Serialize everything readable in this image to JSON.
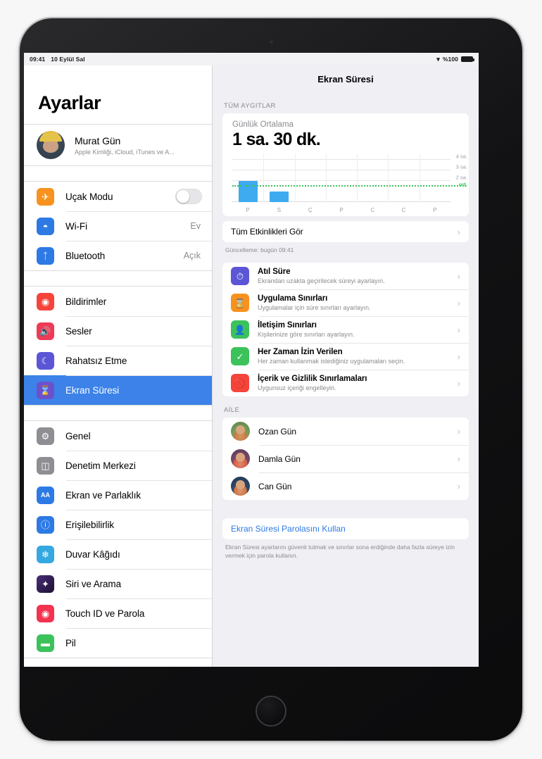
{
  "status_bar": {
    "time": "09:41",
    "date": "10 Eylül Sal",
    "wifi_icon": "wifi-icon",
    "battery_percent": "%100",
    "battery_icon": "battery-full-icon"
  },
  "sidebar": {
    "title": "Ayarlar",
    "user": {
      "name": "Murat Gün",
      "subtitle": "Apple Kimliği, iCloud, iTunes ve A..."
    },
    "group1": [
      {
        "label": "Uçak Modu",
        "icon": "airplane-icon",
        "icon_color": "#f7921e",
        "control": "toggle",
        "toggle_on": false
      },
      {
        "label": "Wi-Fi",
        "icon": "wifi-icon",
        "icon_color": "#2d7ae5",
        "value": "Ev"
      },
      {
        "label": "Bluetooth",
        "icon": "bluetooth-icon",
        "icon_color": "#2d7ae5",
        "value": "Açık"
      }
    ],
    "group2": [
      {
        "label": "Bildirimler",
        "icon": "notifications-icon",
        "icon_color": "#f5453b"
      },
      {
        "label": "Sesler",
        "icon": "speaker-icon",
        "icon_color": "#ee3a56"
      },
      {
        "label": "Rahatsız Etme",
        "icon": "moon-icon",
        "icon_color": "#5b56d6"
      },
      {
        "label": "Ekran Süresi",
        "icon": "hourglass-icon",
        "icon_color": "#6a52cf",
        "selected": true
      }
    ],
    "group3": [
      {
        "label": "Genel",
        "icon": "gear-icon",
        "icon_color": "#8e8e93"
      },
      {
        "label": "Denetim Merkezi",
        "icon": "control-center-icon",
        "icon_color": "#8e8e93"
      },
      {
        "label": "Ekran ve Parlaklık",
        "icon": "display-icon",
        "icon_color": "#2d7ae5",
        "glyph": "AA"
      },
      {
        "label": "Erişilebilirlik",
        "icon": "accessibility-icon",
        "icon_color": "#2d7ae5"
      },
      {
        "label": "Duvar Kâğıdı",
        "icon": "wallpaper-icon",
        "icon_color": "#35a8e0"
      },
      {
        "label": "Siri ve Arama",
        "icon": "siri-icon",
        "icon_color": "#2b1b4a"
      },
      {
        "label": "Touch ID ve Parola",
        "icon": "touchid-icon",
        "icon_color": "#f3334f"
      },
      {
        "label": "Pil",
        "icon": "battery-icon",
        "icon_color": "#3cc25b"
      }
    ]
  },
  "detail": {
    "header_title": "Ekran Süresi",
    "all_devices_header": "TÜM AYGITLAR",
    "daily_average_label": "Günlük Ortalama",
    "daily_average_value": "1 sa. 30 dk.",
    "see_all_activity": "Tüm Etkinlikleri Gör",
    "update_note": "Güncelleme: bugün 09:41",
    "settings_rows": [
      {
        "title": "Atıl Süre",
        "subtitle": "Ekrandan uzakta geçirilecek süreyi ayarlayın.",
        "icon": "downtime-icon",
        "icon_color": "#5b56d6"
      },
      {
        "title": "Uygulama Sınırları",
        "subtitle": "Uygulamalar için süre sınırları ayarlayın.",
        "icon": "hourglass-icon",
        "icon_color": "#f7921e"
      },
      {
        "title": "İletişim Sınırları",
        "subtitle": "Kişilerinize göre sınırları ayarlayın.",
        "icon": "person-icon",
        "icon_color": "#3cc25b"
      },
      {
        "title": "Her Zaman İzin Verilen",
        "subtitle": "Her zaman kullanmak istediğiniz uygulamaları seçin.",
        "icon": "checkmark-icon",
        "icon_color": "#3cc25b"
      },
      {
        "title": "İçerik ve Gizlilik Sınırlamaları",
        "subtitle": "Uygunsuz içeriği engelleyin.",
        "icon": "block-icon",
        "icon_color": "#f5453b"
      }
    ],
    "family_header": "AİLE",
    "family": [
      {
        "name": "Ozan Gün",
        "avatar": "avatar-ozan"
      },
      {
        "name": "Damla Gün",
        "avatar": "avatar-damla"
      },
      {
        "name": "Can Gün",
        "avatar": "avatar-can"
      }
    ],
    "passcode_link": "Ekran Süresi Parolasını Kullan",
    "passcode_note": "Ekran Süresi ayarlarını güvenli tutmak ve sınırlar sona erdiğinde daha fazla süreye izin vermek için parola kullanın."
  },
  "chart_data": {
    "type": "bar",
    "title": "Günlük Ortalama",
    "categories": [
      "P",
      "S",
      "Ç",
      "P",
      "C",
      "C",
      "P"
    ],
    "values": [
      2.0,
      1.0,
      0,
      0,
      0,
      0,
      0
    ],
    "ylabel": "",
    "xlabel": "",
    "ylim": [
      0,
      4.4
    ],
    "yticks": [
      2,
      3,
      4
    ],
    "ytick_labels": [
      "2 sa.",
      "3 sa.",
      "4 sa."
    ],
    "average_line": 1.5,
    "average_label": "ort.",
    "bar_color": "#3eaaf0",
    "average_color": "#3cc25b",
    "grid": true,
    "legend": "none"
  }
}
